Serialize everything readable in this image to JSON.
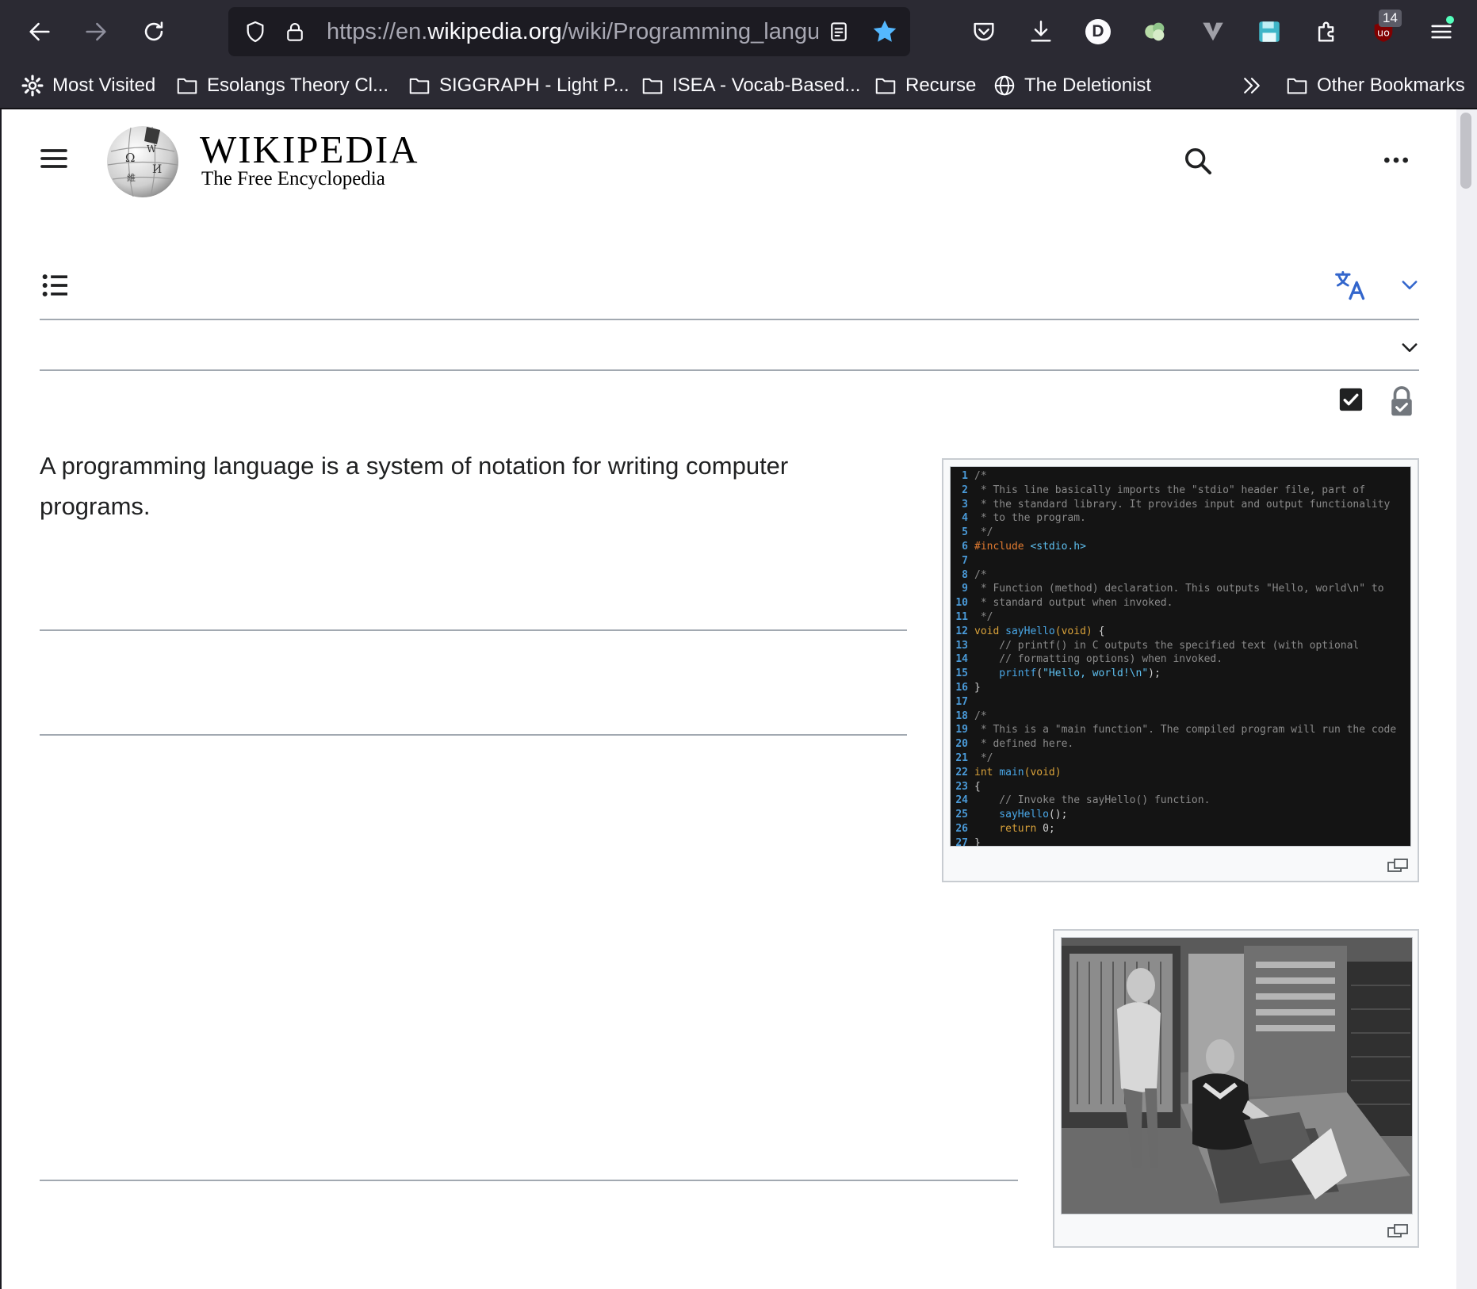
{
  "browser": {
    "url": {
      "prefix": "https://en.",
      "host": "wikipedia.org",
      "path": "/wiki/Programming_langu"
    },
    "extensions_badge": "14",
    "profile_letter": "D",
    "bookmarks": [
      "Most Visited",
      "Esolangs Theory Cl...",
      "SIGGRAPH - Light P...",
      "ISEA - Vocab-Based...",
      "Recurse",
      "The Deletionist",
      "Other Bookmarks"
    ]
  },
  "wiki": {
    "wordmark": "WIKIPEDIA",
    "tagline": "The Free Encyclopedia",
    "lead": "A programming language is a system of notation for writing computer programs."
  },
  "code_lines": [
    [
      [
        "cm",
        "/*"
      ]
    ],
    [
      [
        "cm",
        " * This line basically imports the \"stdio\" header file, part of"
      ]
    ],
    [
      [
        "cm",
        " * the standard library. It provides input and output functionality"
      ]
    ],
    [
      [
        "cm",
        " * to the program."
      ]
    ],
    [
      [
        "cm",
        " */"
      ]
    ],
    [
      [
        "pp",
        "#include "
      ],
      [
        "st",
        "<stdio.h>"
      ]
    ],
    [],
    [
      [
        "cm",
        "/*"
      ]
    ],
    [
      [
        "cm",
        " * Function (method) declaration. This outputs \"Hello, world\\n\" to"
      ]
    ],
    [
      [
        "cm",
        " * standard output when invoked."
      ]
    ],
    [
      [
        "cm",
        " */"
      ]
    ],
    [
      [
        "kw",
        "void "
      ],
      [
        "fn",
        "sayHello"
      ],
      [
        "kw",
        "(void) "
      ],
      [
        "tx",
        "{"
      ]
    ],
    [
      [
        "cm",
        "    // printf() in C outputs the specified text (with optional"
      ]
    ],
    [
      [
        "cm",
        "    // formatting options) when invoked."
      ]
    ],
    [
      [
        "fn",
        "    printf"
      ],
      [
        "tx",
        "("
      ],
      [
        "st",
        "\"Hello, world!\\n\""
      ],
      [
        "tx",
        ");"
      ]
    ],
    [
      [
        "tx",
        "}"
      ]
    ],
    [],
    [
      [
        "cm",
        "/*"
      ]
    ],
    [
      [
        "cm",
        " * This is a \"main function\". The compiled program will run the code"
      ]
    ],
    [
      [
        "cm",
        " * defined here."
      ]
    ],
    [
      [
        "cm",
        " */"
      ]
    ],
    [
      [
        "kw",
        "int "
      ],
      [
        "fn",
        "main"
      ],
      [
        "kw",
        "(void)"
      ]
    ],
    [
      [
        "tx",
        "{"
      ]
    ],
    [
      [
        "cm",
        "    // Invoke the sayHello() function."
      ]
    ],
    [
      [
        "fn",
        "    sayHello"
      ],
      [
        "tx",
        "();"
      ]
    ],
    [
      [
        "kw",
        "    return "
      ],
      [
        "tx",
        "0;"
      ]
    ],
    [
      [
        "tx",
        "}"
      ]
    ]
  ],
  "colors": {
    "chrome_bg": "#2b2a33",
    "link_blue": "#3366cc",
    "bookmark_star": "#54ffbd"
  }
}
